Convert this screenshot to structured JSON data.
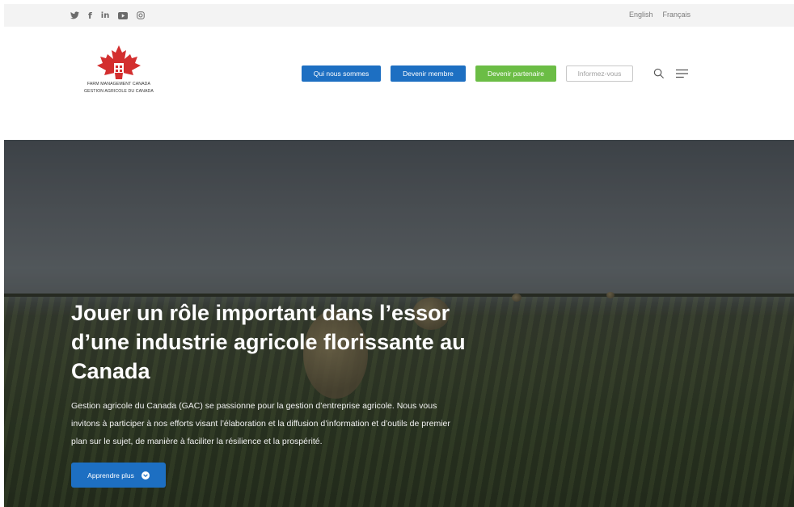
{
  "topbar": {
    "social": [
      {
        "name": "twitter-icon",
        "glyph": "🐦"
      },
      {
        "name": "facebook-icon",
        "glyph": "f"
      },
      {
        "name": "linkedin-icon",
        "glyph": "in"
      },
      {
        "name": "youtube-icon",
        "glyph": "▶"
      },
      {
        "name": "instagram-icon",
        "glyph": "◎"
      }
    ],
    "lang_english": "English",
    "lang_french": "Français"
  },
  "logo": {
    "line1": "FARM MANAGEMENT CANADA",
    "line2": "GESTION AGRICOLE DU CANADA",
    "color": "#d32f2f"
  },
  "nav": {
    "who": "Qui nous sommes",
    "member": "Devenir membre",
    "partner": "Devenir partenaire",
    "inform": "Informez-vous"
  },
  "hero": {
    "title": "Jouer un rôle important dans l’essor d’une industrie agricole florissante au Canada",
    "text": "Gestion agricole du Canada (GAC) se passionne pour la gestion d’entreprise agricole. Nous vous invitons à participer à nos efforts visant l’élaboration et la diffusion d’information et d’outils de premier plan sur le sujet, de manière à faciliter la résilience et la prospérité.",
    "cta": "Apprendre plus"
  },
  "colors": {
    "blue": "#1d6fc2",
    "green": "#6bbd45"
  }
}
